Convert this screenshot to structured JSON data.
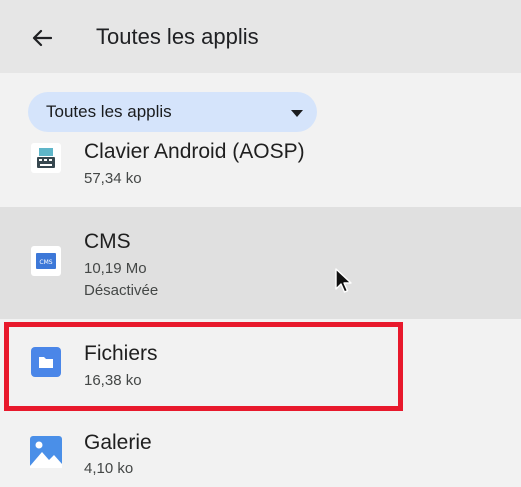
{
  "header": {
    "back_icon": "arrow-left-icon",
    "title": "Toutes les applis"
  },
  "filter": {
    "label": "Toutes les applis",
    "dropdown_icon": "caret-down-icon"
  },
  "apps": [
    {
      "name": "Clavier Android (AOSP)",
      "size": "57,34 ko",
      "icon": "keyboard-app-icon"
    },
    {
      "name": "CMS",
      "size": "10,19 Mo",
      "status": "Désactivée",
      "icon": "cms-app-icon"
    },
    {
      "name": "Fichiers",
      "size": "16,38 ko",
      "icon": "folder-app-icon"
    },
    {
      "name": "Galerie",
      "size": "4,10 ko",
      "icon": "gallery-app-icon"
    }
  ],
  "colors": {
    "highlight_border": "#e8192c",
    "chip_background": "#d5e4fb",
    "selected_row": "#e0e0e0",
    "header_background": "#e6e6e6"
  }
}
